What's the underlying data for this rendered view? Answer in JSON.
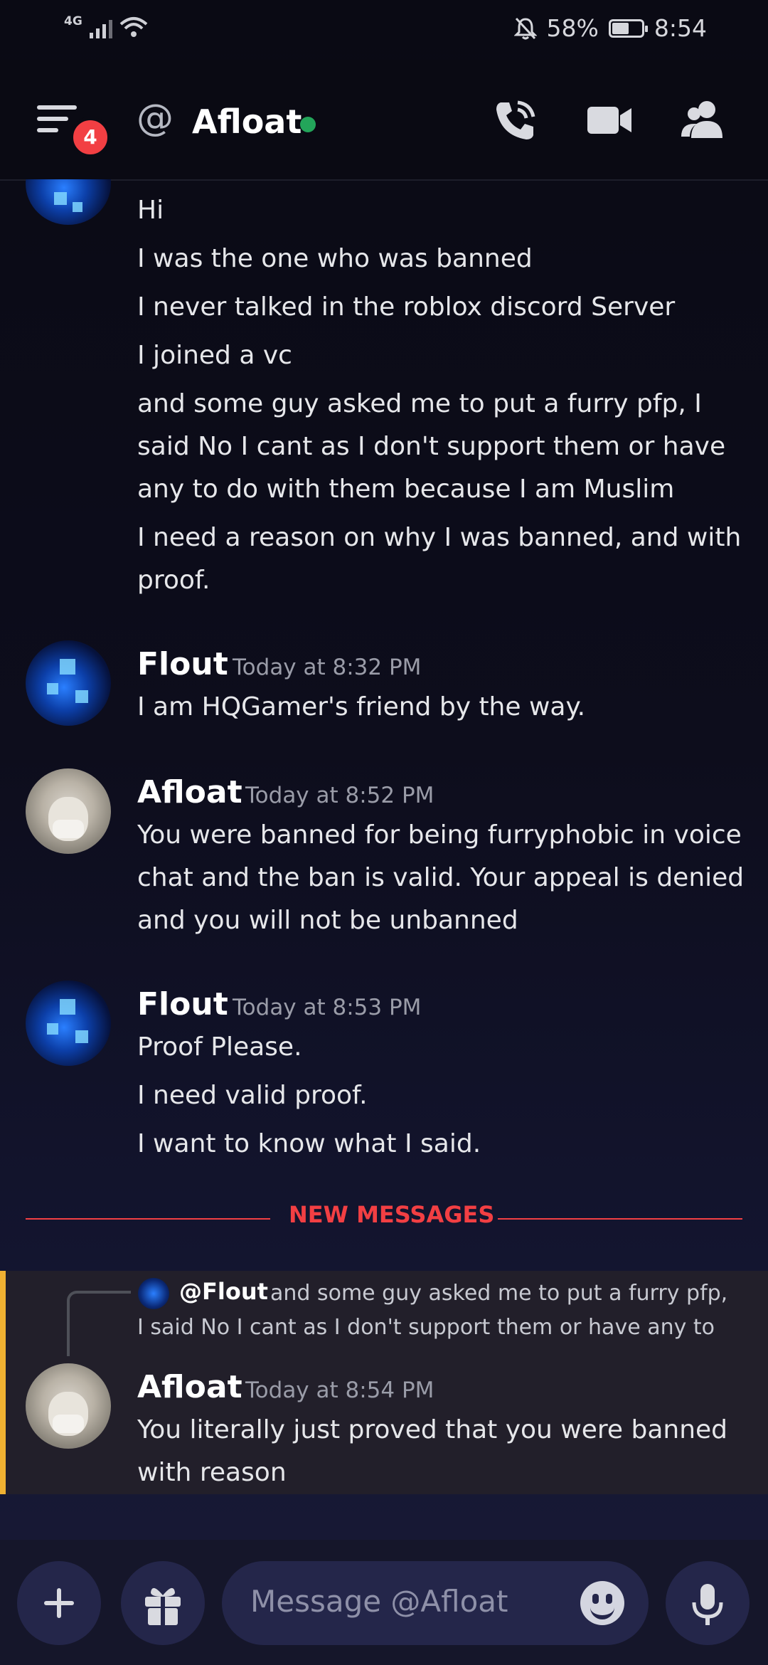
{
  "status_bar": {
    "network": "4G",
    "battery_percent": "58%",
    "battery_level": 0.58,
    "time": "8:54"
  },
  "header": {
    "at_symbol": "@",
    "title": "Afloat",
    "notification_count": "4",
    "status": "online"
  },
  "messages_top": {
    "lines": [
      "Hi",
      "I was the one who was banned",
      "I never talked in the roblox discord Server",
      "I joined a vc",
      "and some guy asked me to put a furry pfp, I",
      "said No I cant as I don't support them or have",
      "any to do with them because I am Muslim",
      "I need a reason on why I was banned, and with",
      "proof."
    ]
  },
  "msg1": {
    "author": "Flout",
    "time": "Today at 8:32 PM",
    "lines": [
      "I am HQGamer's friend by the way."
    ]
  },
  "msg2": {
    "author": "Afloat",
    "time": "Today at 8:52 PM",
    "lines": [
      "You were banned for being furryphobic in voice",
      "chat and the ban is valid. Your appeal is denied",
      "and you will not be unbanned"
    ]
  },
  "msg3": {
    "author": "Flout",
    "time": "Today at 8:53 PM",
    "lines": [
      "Proof Please.",
      "I need valid proof.",
      "I want to know what I said."
    ]
  },
  "new_messages_label": "NEW MESSAGES",
  "reply": {
    "mention": "@Flout",
    "text_line1": "and some guy asked me to put a furry pfp,",
    "text_line2": "I said No I cant as I don't support them or have any to"
  },
  "msg4": {
    "author": "Afloat",
    "time": "Today at 8:54 PM",
    "lines": [
      "You literally just proved that you were banned",
      "with reason"
    ]
  },
  "composer": {
    "placeholder": "Message @Afloat"
  },
  "colors": {
    "accent_red": "#f23f43",
    "online_green": "#23a55a",
    "highlight_bar": "#f0b132"
  }
}
